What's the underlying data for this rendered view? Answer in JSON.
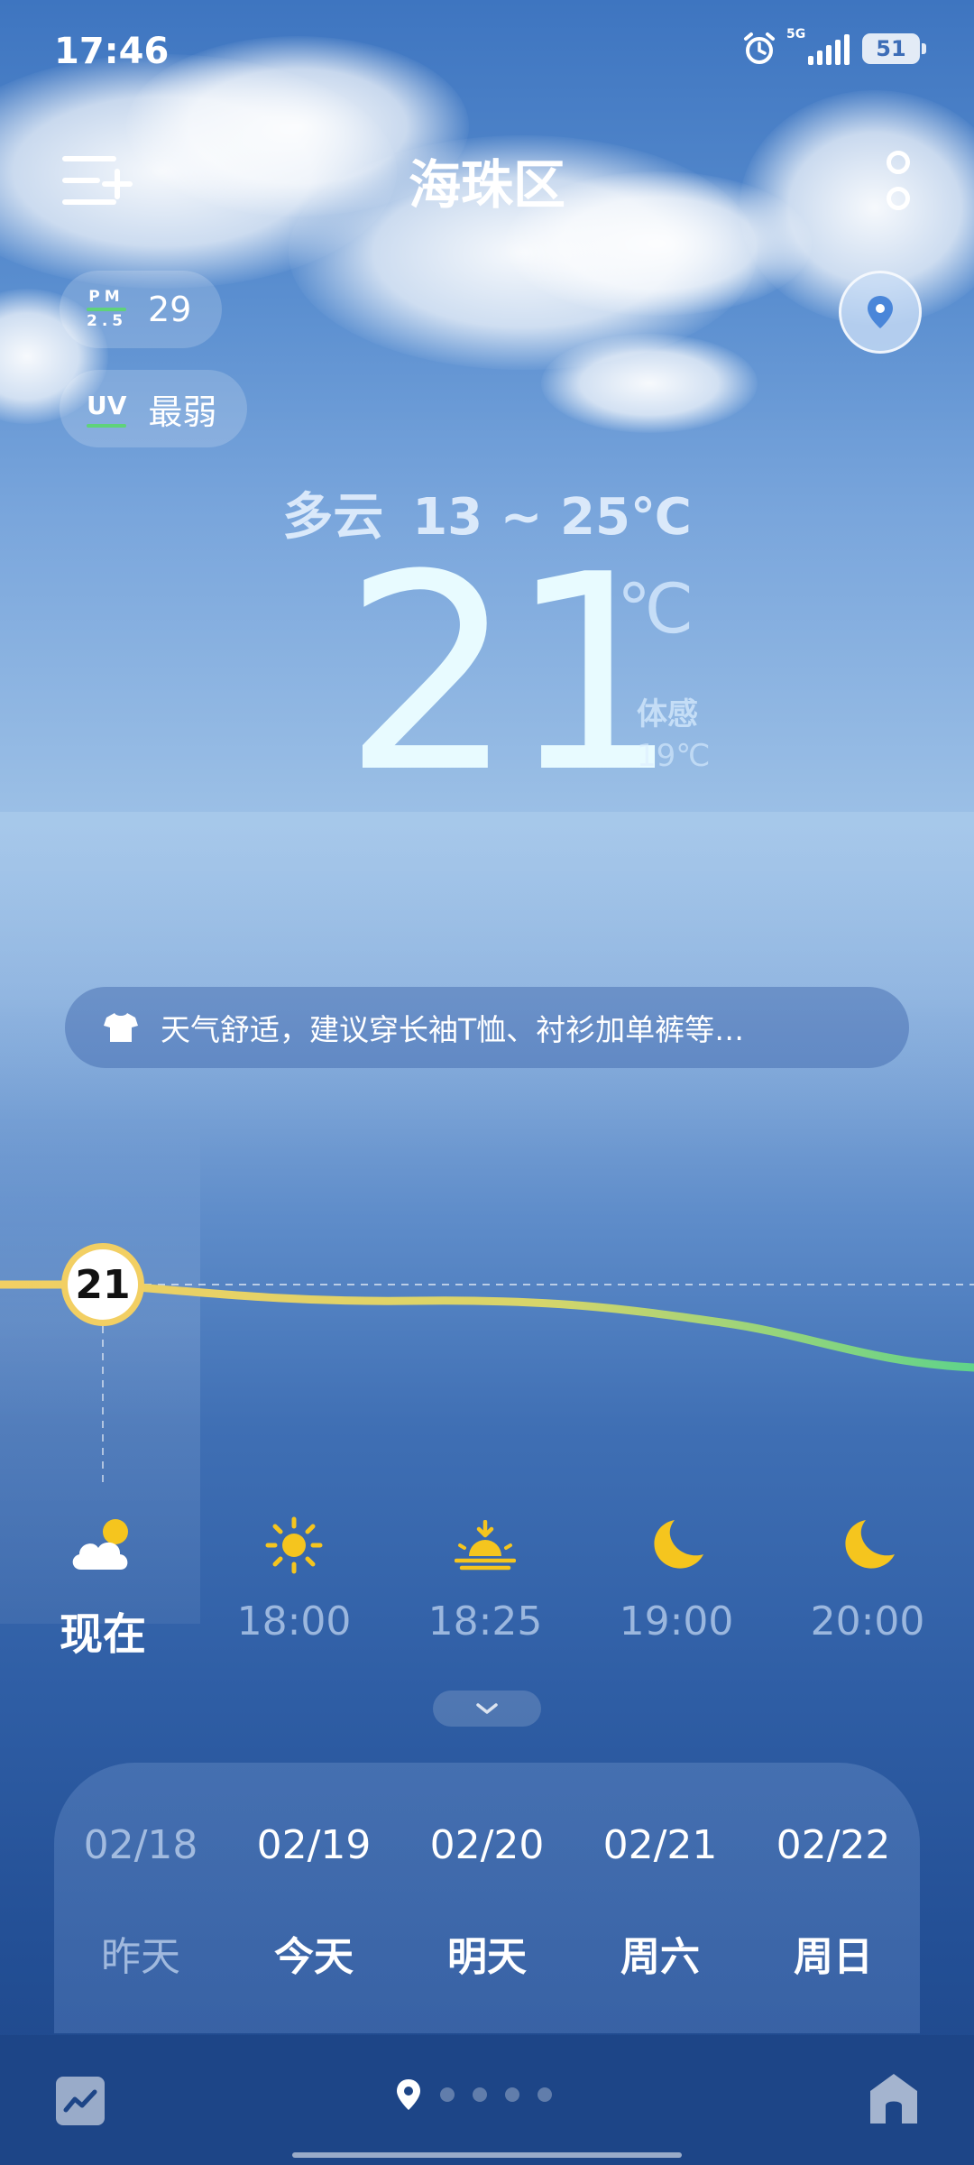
{
  "status_bar": {
    "time": "17:46",
    "network": "5G",
    "battery": "51"
  },
  "header": {
    "city": "海珠区"
  },
  "air": {
    "pm_label_top": "PM",
    "pm_label_bottom": "2.5",
    "pm_value": "29",
    "uv_label": "UV",
    "uv_value": "最弱"
  },
  "current": {
    "condition": "多云",
    "range": "13 ~ 25℃",
    "temperature": "21",
    "unit": "℃",
    "feels_label": "体感",
    "feels_value": "19℃"
  },
  "tip": {
    "text": "天气舒适，建议穿长袖T恤、衬衫加单裤等…"
  },
  "hourly": {
    "marker_value": "21",
    "items": [
      {
        "label": "现在",
        "icon": "partly-cloudy-icon"
      },
      {
        "label": "18:00",
        "icon": "sun-icon"
      },
      {
        "label": "18:25",
        "icon": "sunset-icon"
      },
      {
        "label": "19:00",
        "icon": "moon-icon"
      },
      {
        "label": "20:00",
        "icon": "moon-icon"
      }
    ]
  },
  "daily": [
    {
      "date": "02/18",
      "name": "昨天"
    },
    {
      "date": "02/19",
      "name": "今天"
    },
    {
      "date": "02/20",
      "name": "明天"
    },
    {
      "date": "02/21",
      "name": "周六"
    },
    {
      "date": "02/22",
      "name": "周日"
    }
  ],
  "colors": {
    "accent_yellow": "#f2cf63",
    "trend_green": "#5fd37a"
  }
}
